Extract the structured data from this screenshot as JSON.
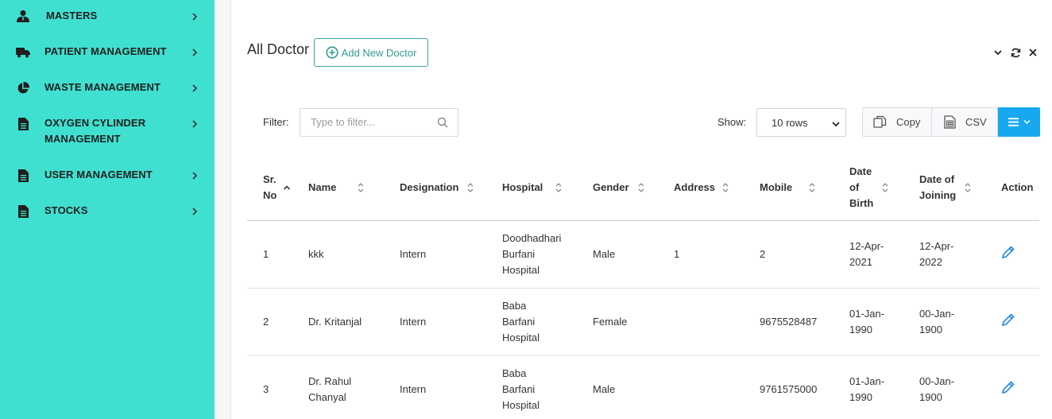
{
  "sidebar": {
    "items": [
      {
        "label": "MASTERS",
        "icon": "user-tie-icon"
      },
      {
        "label": "PATIENT MANAGEMENT",
        "icon": "truck-icon"
      },
      {
        "label": "WASTE MANAGEMENT",
        "icon": "pie-chart-icon"
      },
      {
        "label": "OXYGEN CYLINDER",
        "label2": "MANAGEMENT",
        "icon": "document-icon"
      },
      {
        "label": "USER MANAGEMENT",
        "icon": "document-icon"
      },
      {
        "label": "STOCKS",
        "icon": "document-icon"
      }
    ]
  },
  "header": {
    "title": "All Doctor",
    "add_button": "Add New Doctor"
  },
  "toolbar": {
    "filter_label": "Filter:",
    "filter_placeholder": "Type to filter...",
    "show_label": "Show:",
    "show_value": "10 rows",
    "copy_label": "Copy",
    "csv_label": "CSV"
  },
  "table": {
    "columns": [
      {
        "line1": "Sr.",
        "line2": "No"
      },
      {
        "line1": "Name"
      },
      {
        "line1": "Designation"
      },
      {
        "line1": "Hospital"
      },
      {
        "line1": "Gender"
      },
      {
        "line1": "Address"
      },
      {
        "line1": "Mobile"
      },
      {
        "line1": "Date",
        "line2": "of",
        "line3": "Birth"
      },
      {
        "line1": "Date of",
        "line2": "Joining"
      },
      {
        "line1": "Action"
      }
    ],
    "rows": [
      {
        "sr": "1",
        "name1": "kkk",
        "name2": "",
        "designation": "Intern",
        "hosp1": "Doodhadhari",
        "hosp2": "Burfani",
        "hosp3": "Hospital",
        "gender": "Male",
        "address": "1",
        "mobile": "2",
        "dob1": "12-Apr-",
        "dob2": "2021",
        "doj1": "12-Apr-",
        "doj2": "2022"
      },
      {
        "sr": "2",
        "name1": "Dr. Kritanjal",
        "name2": "",
        "designation": "Intern",
        "hosp1": "Baba",
        "hosp2": "Barfani",
        "hosp3": "Hospital",
        "gender": "Female",
        "address": "",
        "mobile": "9675528487",
        "dob1": "01-Jan-",
        "dob2": "1990",
        "doj1": "00-Jan-",
        "doj2": "1900"
      },
      {
        "sr": "3",
        "name1": "Dr. Rahul",
        "name2": "Chanyal",
        "designation": "Intern",
        "hosp1": "Baba",
        "hosp2": "Barfani",
        "hosp3": "Hospital",
        "gender": "Male",
        "address": "",
        "mobile": "9761575000",
        "dob1": "01-Jan-",
        "dob2": "1990",
        "doj1": "00-Jan-",
        "doj2": "1900"
      }
    ]
  },
  "colors": {
    "sidebar_bg": "#40e0d0",
    "accent": "#2f9a92",
    "menu_button": "#17a8f0",
    "edit_icon": "#1e88e5"
  }
}
